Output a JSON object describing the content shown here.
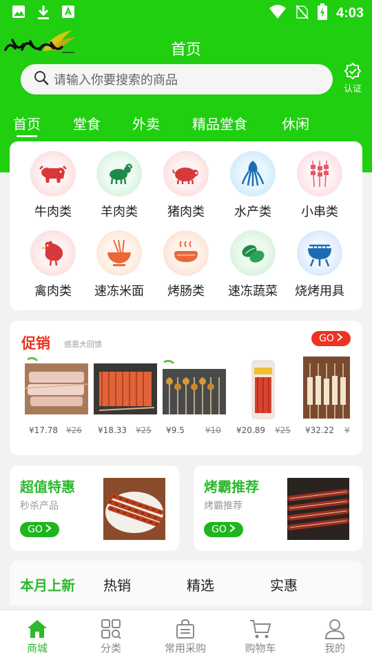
{
  "status_bar": {
    "time": "4:03"
  },
  "header": {
    "title": "首页",
    "search_placeholder": "请输入你要搜索的商品",
    "certify_label": "认证"
  },
  "tabs": [
    "首页",
    "堂食",
    "外卖",
    "精品堂食",
    "休闲"
  ],
  "categories": [
    {
      "label": "牛肉类",
      "icon": "cow-icon"
    },
    {
      "label": "羊肉类",
      "icon": "sheep-icon"
    },
    {
      "label": "猪肉类",
      "icon": "pig-icon"
    },
    {
      "label": "水产类",
      "icon": "squid-icon"
    },
    {
      "label": "小串类",
      "icon": "skewer-icon"
    },
    {
      "label": "禽肉类",
      "icon": "chicken-icon"
    },
    {
      "label": "速冻米面",
      "icon": "noodle-bowl-icon"
    },
    {
      "label": "烤肠类",
      "icon": "sausage-icon"
    },
    {
      "label": "速冻蔬菜",
      "icon": "vegetable-icon"
    },
    {
      "label": "烧烤用具",
      "icon": "grill-icon"
    }
  ],
  "promo": {
    "title": "促销",
    "subtitle": "感恩大回馈",
    "go_label": "GO",
    "products": [
      {
        "price": "¥17.78",
        "old_price": "¥26"
      },
      {
        "price": "¥18.33",
        "old_price": "¥25"
      },
      {
        "price": "¥9.5",
        "old_price": "¥10"
      },
      {
        "price": "¥20.89",
        "old_price": "¥25"
      },
      {
        "price": "¥32.22",
        "old_price": "¥"
      }
    ]
  },
  "features": [
    {
      "title": "超值特惠",
      "subtitle": "秒杀产品",
      "go_label": "GO"
    },
    {
      "title": "烤霸推荐",
      "subtitle": "烤霸推荐",
      "go_label": "GO"
    }
  ],
  "month_tabs": [
    "本月上新",
    "热销",
    "精选",
    "实惠"
  ],
  "bottom_nav": [
    "商城",
    "分类",
    "常用采购",
    "购物车",
    "我的"
  ],
  "colors": {
    "brand_green": "#1fcf10",
    "accent_green": "#2eb82e",
    "promo_red": "#ef3322"
  }
}
